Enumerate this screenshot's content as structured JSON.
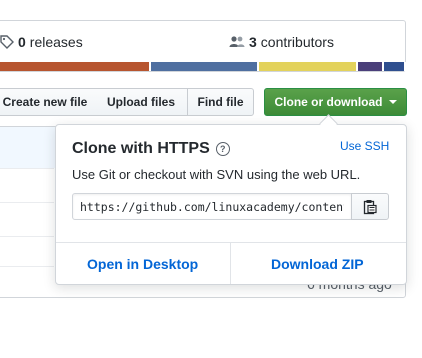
{
  "summary": {
    "releases_count": "0",
    "releases_label": "releases",
    "contributors_count": "3",
    "contributors_label": "contributors",
    "language_colors": [
      "#b7552f",
      "#4f6fa0",
      "#e3d25b",
      "#4a3f7a",
      "#2f4f8f"
    ]
  },
  "toolbar": {
    "create_new_file": "Create new file",
    "upload_files": "Upload files",
    "find_file": "Find file",
    "clone_or_download": "Clone or download"
  },
  "clone_popover": {
    "title": "Clone with HTTPS",
    "help_icon": "question-circle-icon",
    "use_ssh": "Use SSH",
    "description": "Use Git or checkout with SVN using the web URL.",
    "url": "https://github.com/linuxacademy/content",
    "copy_icon": "clipboard-icon",
    "open_in_desktop": "Open in Desktop",
    "download_zip": "Download ZIP"
  },
  "file_list": {
    "last_updated": "6 months ago"
  },
  "colors": {
    "accent_green": "#3d8b37",
    "link_blue": "#0366d6"
  }
}
